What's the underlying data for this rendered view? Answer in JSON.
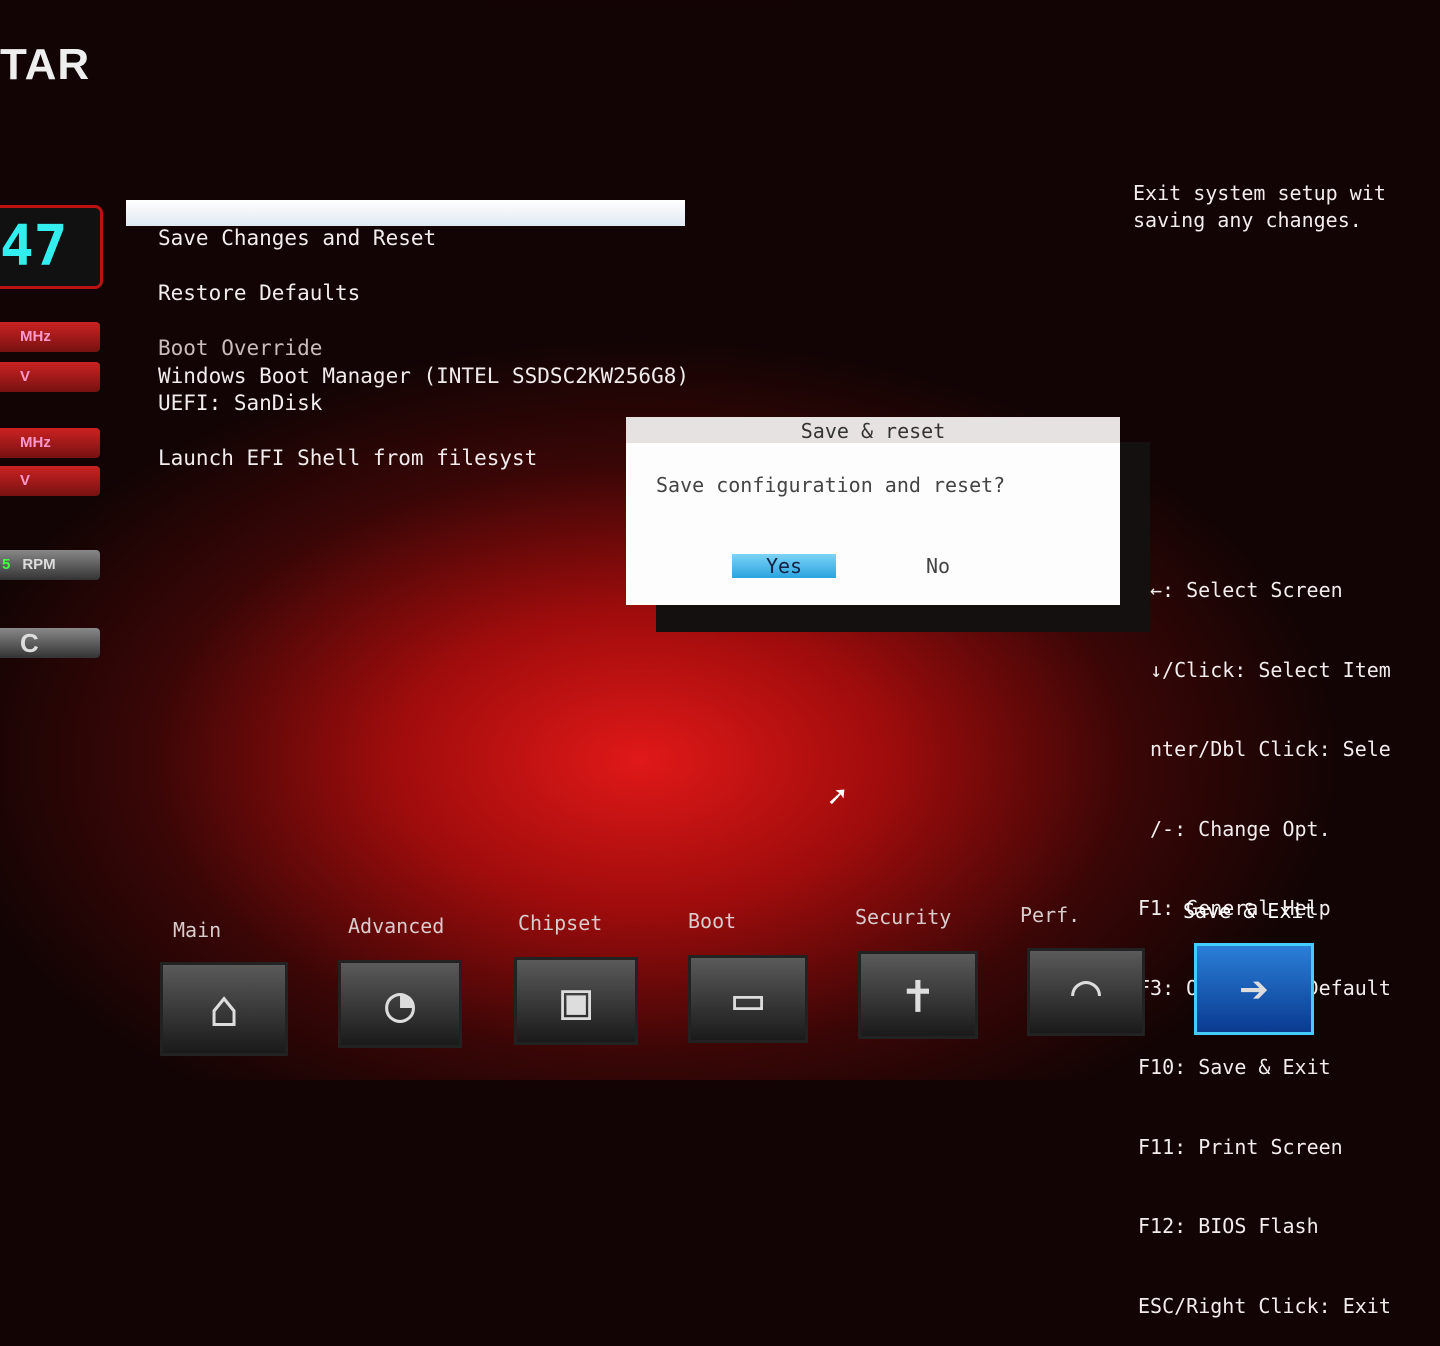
{
  "brand": {
    "logo_text": "TAR"
  },
  "sidebar": {
    "cpu_temp": "47",
    "gauges": [
      {
        "unit": "MHz"
      },
      {
        "unit": "V"
      },
      {
        "unit": "MHz"
      },
      {
        "unit": "V"
      },
      {
        "unit": "RPM",
        "value": "5"
      },
      {
        "unit": "C"
      }
    ]
  },
  "menu": {
    "items": [
      {
        "label": "Save Changes and Reset"
      },
      {
        "label": "Restore Defaults"
      }
    ],
    "boot_override_label": "Boot Override",
    "boot_options": [
      "Windows Boot Manager (INTEL SSDSC2KW256G8)",
      "UEFI: SanDisk"
    ],
    "efi_shell": "Launch EFI Shell from filesyst"
  },
  "help": {
    "description": "Exit system setup wit\nsaving any changes.",
    "keys": [
      "←: Select Screen",
      "↓/Click: Select Item",
      "nter/Dbl Click: Sele",
      "/-: Change Opt.",
      "F1: General Help",
      "F3: Optimized Default",
      "F10: Save & Exit",
      "F11: Print Screen",
      "F12: BIOS Flash",
      "ESC/Right Click: Exit"
    ]
  },
  "dialog": {
    "title": "Save & reset",
    "message": "Save configuration and reset?",
    "yes": "Yes",
    "no": "No"
  },
  "tabs": [
    {
      "label": "Main",
      "icon": "home-icon"
    },
    {
      "label": "Advanced",
      "icon": "joystick-icon"
    },
    {
      "label": "Chipset",
      "icon": "chip-icon"
    },
    {
      "label": "Boot",
      "icon": "drive-icon"
    },
    {
      "label": "Security",
      "icon": "shield-icon"
    },
    {
      "label": "Perf.",
      "icon": "speedometer-icon"
    },
    {
      "label": "Save & Exit",
      "icon": "folder-exit-icon",
      "active": true
    }
  ],
  "colors": {
    "accent": "#2aa4e0",
    "background": "#a00c0c"
  }
}
